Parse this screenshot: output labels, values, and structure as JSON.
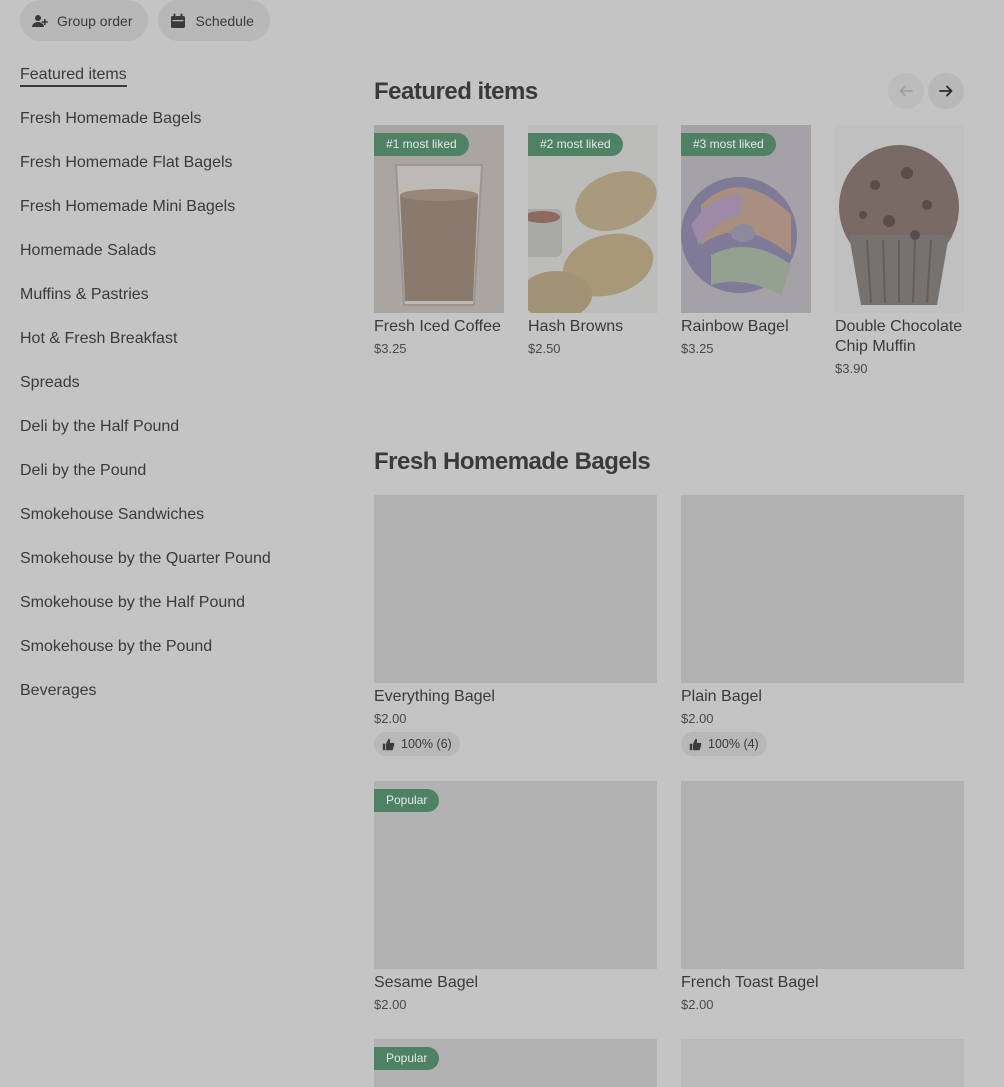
{
  "topbar": {
    "group_order": "Group order",
    "schedule": "Schedule"
  },
  "sidebar": {
    "items": [
      "Featured items",
      "Fresh Homemade Bagels",
      "Fresh Homemade Flat Bagels",
      "Fresh Homemade Mini Bagels",
      "Homemade Salads",
      "Muffins & Pastries",
      "Hot & Fresh Breakfast",
      "Spreads",
      "Deli by the Half Pound",
      "Deli by the Pound",
      "Smokehouse Sandwiches",
      "Smokehouse by the Quarter Pound",
      "Smokehouse by the Half Pound",
      "Smokehouse by the Pound",
      "Beverages"
    ]
  },
  "featured": {
    "title": "Featured items",
    "items": [
      {
        "badge": "#1 most liked",
        "name": "Fresh Iced Coffee",
        "price": "$3.25"
      },
      {
        "badge": "#2 most liked",
        "name": "Hash Browns",
        "price": "$2.50"
      },
      {
        "badge": "#3 most liked",
        "name": "Rainbow Bagel",
        "price": "$3.25"
      },
      {
        "badge": "",
        "name": "Double Chocolate Chip Muffin",
        "price": "$3.90"
      }
    ]
  },
  "bagels": {
    "title": "Fresh Homemade Bagels",
    "items": [
      {
        "badge": "",
        "name": "Everything Bagel",
        "price": "$2.00",
        "rating": "100% (6)"
      },
      {
        "badge": "",
        "name": "Plain Bagel",
        "price": "$2.00",
        "rating": "100% (4)"
      },
      {
        "badge": "Popular",
        "name": "Sesame Bagel",
        "price": "$2.00",
        "rating": ""
      },
      {
        "badge": "",
        "name": "French Toast Bagel",
        "price": "$2.00",
        "rating": ""
      },
      {
        "badge": "Popular",
        "name": "",
        "price": "",
        "rating": ""
      }
    ]
  },
  "colors": {
    "overlay_bg": "#c4c4c4",
    "badge_green": "#4f8264"
  },
  "icons": {
    "group_order": "add-person-icon",
    "schedule": "calendar-icon",
    "prev": "arrow-left-icon",
    "next": "arrow-right-icon",
    "rating": "thumbs-up-icon"
  }
}
